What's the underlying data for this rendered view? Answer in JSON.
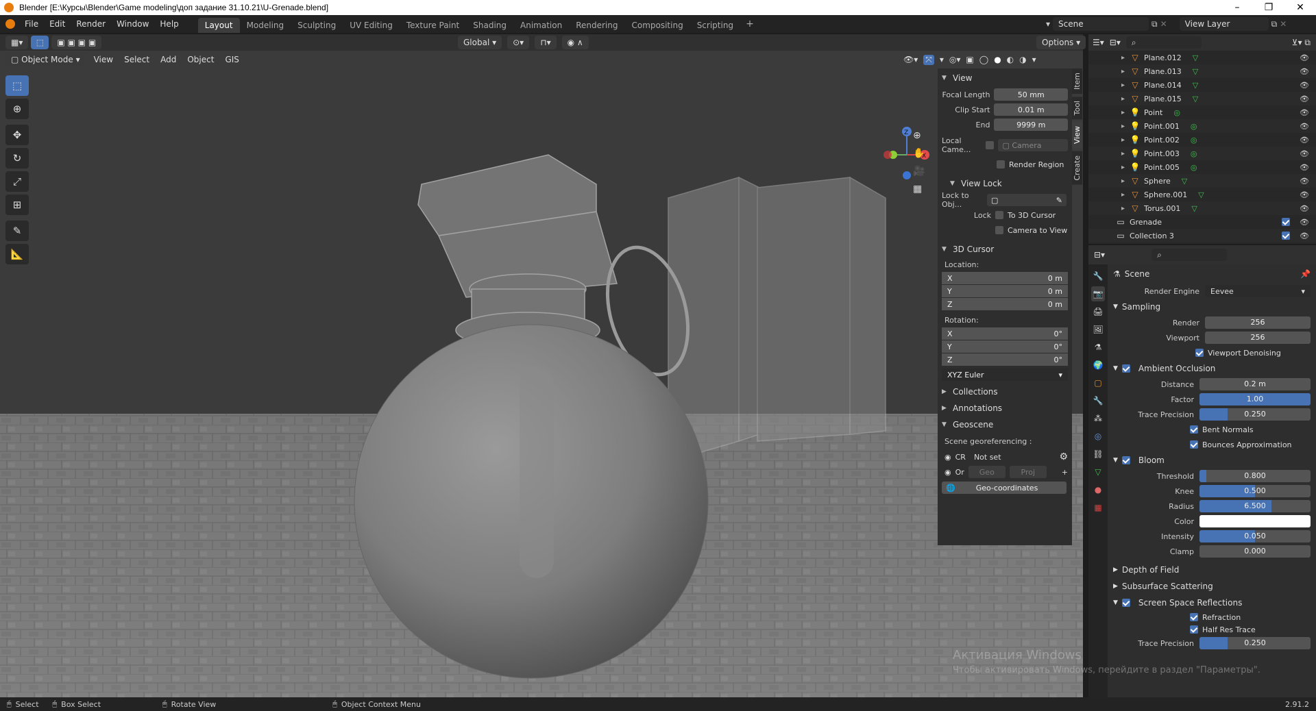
{
  "title": "Blender [E:\\Курсы\\Blender\\Game modeling\\доп задание 31.10.21\\U-Grenade.blend]",
  "window_buttons": [
    "–",
    "❐",
    "✕"
  ],
  "menus": [
    "File",
    "Edit",
    "Render",
    "Window",
    "Help"
  ],
  "workspaces": [
    "Layout",
    "Modeling",
    "Sculpting",
    "UV Editing",
    "Texture Paint",
    "Shading",
    "Animation",
    "Rendering",
    "Compositing",
    "Scripting"
  ],
  "active_workspace": "Layout",
  "scene_name": "Scene",
  "view_layer": "View Layer",
  "header1": {
    "transform": "Global",
    "options": "Options"
  },
  "header2": {
    "mode": "Object Mode",
    "menus": [
      "View",
      "Select",
      "Add",
      "Object",
      "GIS"
    ]
  },
  "npanel": {
    "tabs": [
      "Item",
      "Tool",
      "View",
      "Create"
    ],
    "active_tab": "View",
    "view": {
      "title": "View",
      "focal_length_label": "Focal Length",
      "focal_length": "50 mm",
      "clip_start_label": "Clip Start",
      "clip_start": "0.01 m",
      "end_label": "End",
      "end": "9999 m",
      "local_camera_label": "Local Came...",
      "camera": "Camera",
      "render_region": "Render Region"
    },
    "view_lock": {
      "title": "View Lock",
      "lock_to_obj_label": "Lock to Obj...",
      "lock_label": "Lock",
      "to_3d_cursor": "To 3D Cursor",
      "camera_to_view": "Camera to View"
    },
    "cursor": {
      "title": "3D Cursor",
      "location_label": "Location:",
      "location": [
        {
          "axis": "X",
          "value": "0 m"
        },
        {
          "axis": "Y",
          "value": "0 m"
        },
        {
          "axis": "Z",
          "value": "0 m"
        }
      ],
      "rotation_label": "Rotation:",
      "rotation": [
        {
          "axis": "X",
          "value": "0°"
        },
        {
          "axis": "Y",
          "value": "0°"
        },
        {
          "axis": "Z",
          "value": "0°"
        }
      ],
      "rotation_mode": "XYZ Euler"
    },
    "collections": "Collections",
    "annotations": "Annotations",
    "geoscene": {
      "title": "Geoscene",
      "subtitle": "Scene georeferencing :",
      "cr": "CR",
      "cr_value": "Not set",
      "or": "Or",
      "geo": "Geo",
      "proj": "Proj",
      "geo_coords": "Geo-coordinates"
    }
  },
  "outliner": {
    "items": [
      {
        "name": "Plane.012",
        "type": "mesh"
      },
      {
        "name": "Plane.013",
        "type": "mesh"
      },
      {
        "name": "Plane.014",
        "type": "mesh"
      },
      {
        "name": "Plane.015",
        "type": "mesh"
      },
      {
        "name": "Point",
        "type": "light"
      },
      {
        "name": "Point.001",
        "type": "light"
      },
      {
        "name": "Point.002",
        "type": "light"
      },
      {
        "name": "Point.003",
        "type": "light"
      },
      {
        "name": "Point.005",
        "type": "light"
      },
      {
        "name": "Sphere",
        "type": "mesh"
      },
      {
        "name": "Sphere.001",
        "type": "mesh"
      },
      {
        "name": "Torus.001",
        "type": "mesh"
      },
      {
        "name": "Grenade",
        "type": "collection"
      },
      {
        "name": "Collection 3",
        "type": "collection"
      }
    ]
  },
  "properties": {
    "context": "Scene",
    "render_engine_label": "Render Engine",
    "render_engine": "Eevee",
    "sampling": {
      "title": "Sampling",
      "render_label": "Render",
      "render": "256",
      "viewport_label": "Viewport",
      "viewport": "256",
      "denoise": "Viewport Denoising"
    },
    "ao": {
      "title": "Ambient Occlusion",
      "distance_label": "Distance",
      "distance": "0.2 m",
      "factor_label": "Factor",
      "factor": "1.00",
      "factor_fill": 1.0,
      "trace_label": "Trace Precision",
      "trace": "0.250",
      "trace_fill": 0.25,
      "bent": "Bent Normals",
      "bounces": "Bounces Approximation"
    },
    "bloom": {
      "title": "Bloom",
      "threshold_label": "Threshold",
      "threshold": "0.800",
      "threshold_fill": 0.06,
      "knee_label": "Knee",
      "knee": "0.500",
      "knee_fill": 0.5,
      "radius_label": "Radius",
      "radius": "6.500",
      "radius_fill": 0.65,
      "color_label": "Color",
      "color": "#ffffff",
      "intensity_label": "Intensity",
      "intensity": "0.050",
      "intensity_fill": 0.5,
      "clamp_label": "Clamp",
      "clamp": "0.000"
    },
    "dof": "Depth of Field",
    "sss": "Subsurface Scattering",
    "ssr": {
      "title": "Screen Space Reflections",
      "refraction": "Refraction",
      "half_res": "Half Res Trace",
      "trace_label": "Trace Precision",
      "trace": "0.250"
    }
  },
  "status": {
    "select": "Select",
    "box_select": "Box Select",
    "rotate": "Rotate View",
    "context_menu": "Object Context Menu",
    "version": "2.91.2"
  },
  "activation": {
    "line1": "Активация Windows",
    "line2": "Чтобы активировать Windows, перейдите в раздел \"Параметры\"."
  },
  "colors": {
    "accent": "#4772b3",
    "mesh_icon": "#e8923a",
    "vertex_green": "#3fc14d"
  },
  "gizmo": {
    "x": "X",
    "y": "Y",
    "z": "Z"
  }
}
